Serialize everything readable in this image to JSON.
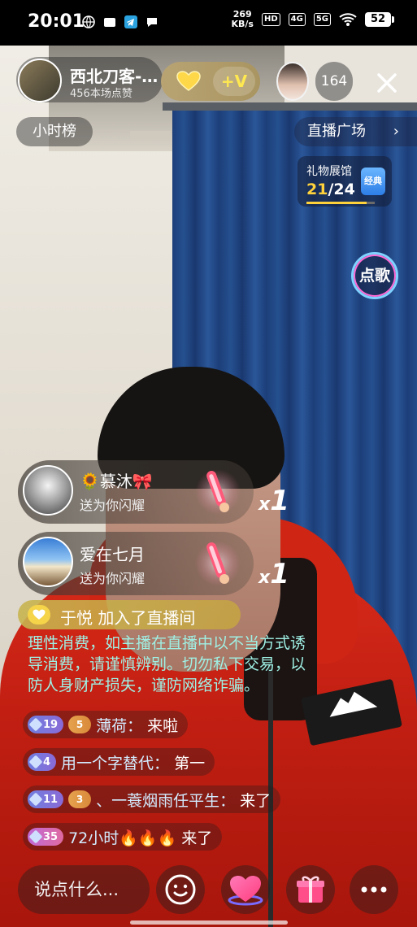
{
  "status_bar": {
    "time": "20:01",
    "net_speed_value": "269",
    "net_speed_unit": "KB/s",
    "hd_tag": "HD",
    "sig1": "4G",
    "sig2": "5G",
    "battery": "52"
  },
  "host": {
    "name": "西北刀客-…",
    "likes": "456本场点赞"
  },
  "fan_club": {
    "plus_label": "+V"
  },
  "viewer_count": "164",
  "hour_rank_label": "小时榜",
  "live_square_label": "直播广场",
  "gift_hall": {
    "title": "礼物展馆",
    "current": "21",
    "total": "/24",
    "badge": "经典",
    "progress": 0.875
  },
  "song_button_label": "点歌",
  "gift_notifications": [
    {
      "name": "🌻慕沐🎀",
      "action": "送为你闪耀",
      "multiplier_x": "x",
      "multiplier": "1"
    },
    {
      "name": "爱在七月",
      "action": "送为你闪耀",
      "multiplier_x": "x",
      "multiplier": "1"
    }
  ],
  "join": {
    "user": "于悦",
    "text": "加入了直播间"
  },
  "notice": "理性消费，如主播在直播中以不当方式诱导消费，请谨慎辨别。切勿私下交易，以防人身财产损失，谨防网络诈骗。",
  "chat": [
    {
      "level": "19",
      "fan_level": "5",
      "user": "薄荷：",
      "text": "来啦"
    },
    {
      "level": "4",
      "user": "用一个字替代：",
      "text": "第一"
    },
    {
      "level": "11",
      "fan_level": "3",
      "user": "、一蓑烟雨任平生：",
      "text": "来了"
    },
    {
      "level": "35",
      "user": "72小时🔥🔥🔥",
      "text": "来了"
    }
  ],
  "bottom_bar": {
    "input_placeholder": "说点什么..."
  },
  "icons": {
    "close": "close-icon",
    "chevron": "chevron-right-icon",
    "emoji": "emoji-icon",
    "heart_gift": "heart-icon",
    "gift": "gift-icon",
    "more": "more-icon"
  }
}
